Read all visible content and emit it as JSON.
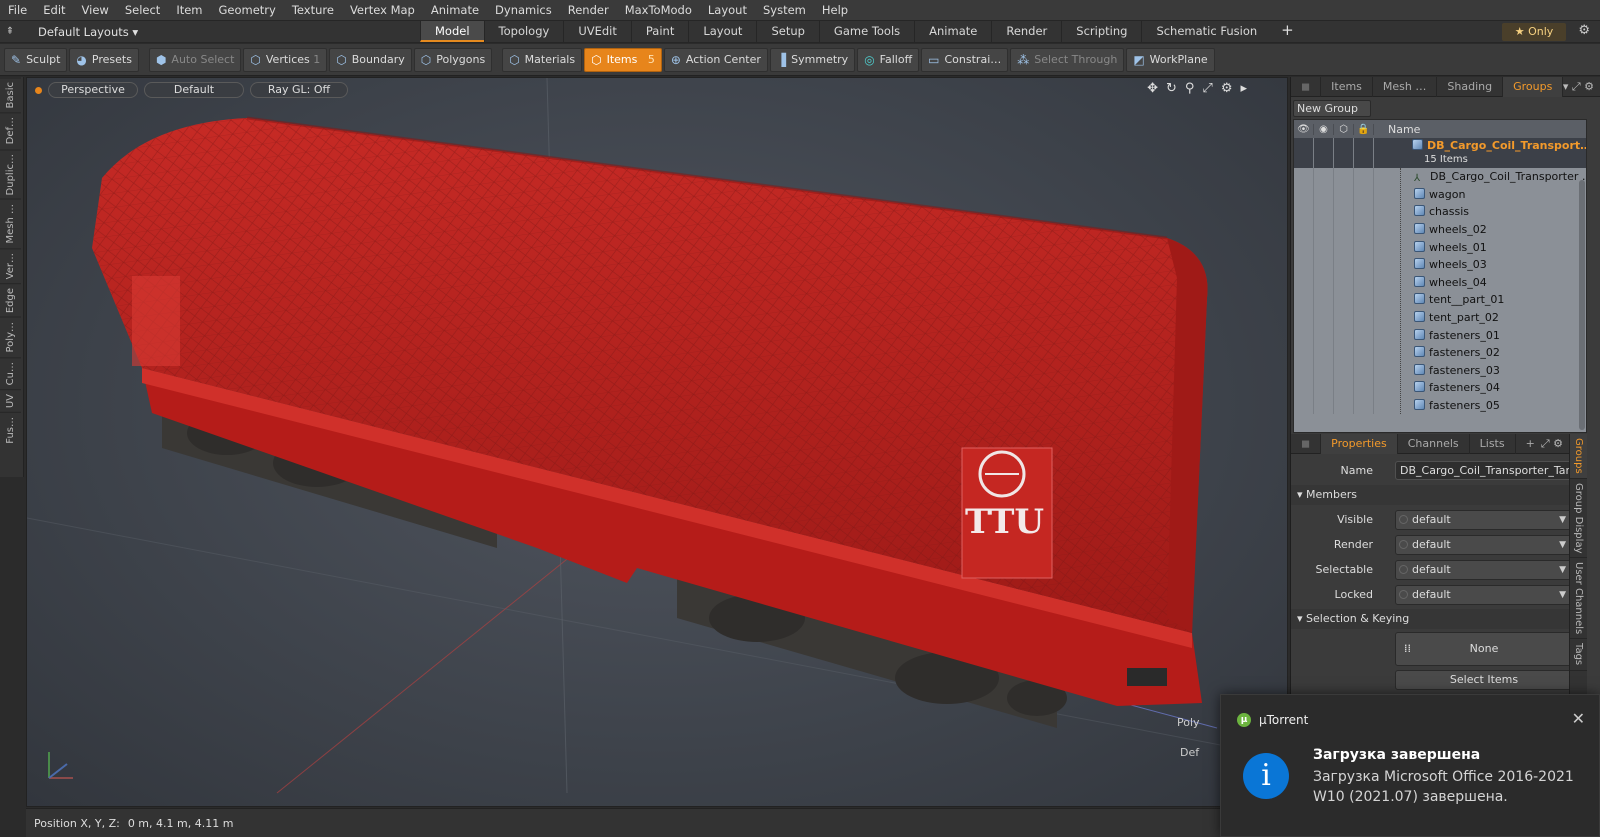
{
  "menu": [
    "File",
    "Edit",
    "View",
    "Select",
    "Item",
    "Geometry",
    "Texture",
    "Vertex Map",
    "Animate",
    "Dynamics",
    "Render",
    "MaxToModo",
    "Layout",
    "System",
    "Help"
  ],
  "layouts": {
    "label": "Default Layouts ▾"
  },
  "tabs": [
    {
      "label": "Model",
      "active": true
    },
    {
      "label": "Topology"
    },
    {
      "label": "UVEdit"
    },
    {
      "label": "Paint"
    },
    {
      "label": "Layout"
    },
    {
      "label": "Setup"
    },
    {
      "label": "Game Tools"
    },
    {
      "label": "Animate"
    },
    {
      "label": "Render"
    },
    {
      "label": "Scripting"
    },
    {
      "label": "Schematic Fusion"
    }
  ],
  "only_label": "★ Only",
  "toolbar": {
    "sculpt": "Sculpt",
    "presets": "Presets",
    "auto_select": "Auto Select",
    "vertices": "Vertices",
    "vertices_count": "1",
    "boundary": "Boundary",
    "polygons": "Polygons",
    "materials": "Materials",
    "items": "Items",
    "items_count": "5",
    "action_center": "Action Center",
    "symmetry": "Symmetry",
    "falloff": "Falloff",
    "constraints": "Constrai…",
    "select_through": "Select Through",
    "workplane": "WorkPlane"
  },
  "left_tabs": [
    "Basic",
    "Def…",
    "Duplic…",
    "Mesh …",
    "Ver…",
    "Edge",
    "Poly…",
    "Cu…",
    "UV",
    "Fus…"
  ],
  "viewport": {
    "view": "Perspective",
    "shading": "Default",
    "raygl": "Ray GL: Off",
    "poly_label": "Poly",
    "def_label": "Def",
    "decal_text": "TTU"
  },
  "status": {
    "label": "Position X, Y, Z:",
    "value": "0 m, 4.1 m, 4.11 m"
  },
  "groups_panel": {
    "tabs": [
      "Items",
      "Mesh …",
      "Shading",
      "Groups"
    ],
    "active_tab": "Groups",
    "new_group": "New Group",
    "col_name": "Name",
    "group_name": "DB_Cargo_Coil_Transport…",
    "group_count": "15 Items",
    "items": [
      {
        "name": "DB_Cargo_Coil_Transporter …",
        "type": "locator"
      },
      {
        "name": "wagon",
        "type": "mesh"
      },
      {
        "name": "chassis",
        "type": "mesh"
      },
      {
        "name": "wheels_02",
        "type": "mesh"
      },
      {
        "name": "wheels_01",
        "type": "mesh"
      },
      {
        "name": "wheels_03",
        "type": "mesh"
      },
      {
        "name": "wheels_04",
        "type": "mesh"
      },
      {
        "name": "tent__part_01",
        "type": "mesh"
      },
      {
        "name": "tent_part_02",
        "type": "mesh"
      },
      {
        "name": "fasteners_01",
        "type": "mesh"
      },
      {
        "name": "fasteners_02",
        "type": "mesh"
      },
      {
        "name": "fasteners_03",
        "type": "mesh"
      },
      {
        "name": "fasteners_04",
        "type": "mesh"
      },
      {
        "name": "fasteners_05",
        "type": "mesh"
      }
    ]
  },
  "props_panel": {
    "tabs": [
      "Properties",
      "Channels",
      "Lists"
    ],
    "name_label": "Name",
    "name_value": "DB_Cargo_Coil_Transporter_Tarp",
    "members_section": "Members",
    "visible_label": "Visible",
    "visible_value": "default",
    "render_label": "Render",
    "render_value": "default",
    "selectable_label": "Selectable",
    "selectable_value": "default",
    "locked_label": "Locked",
    "locked_value": "default",
    "selkey_section": "Selection & Keying",
    "none_label": "None",
    "select_items": "Select Items",
    "side_tabs": [
      "Groups",
      "Group Display",
      "User Channels",
      "Tags"
    ]
  },
  "toast": {
    "app": "µTorrent",
    "title": "Загрузка завершена",
    "message": "Загрузка Microsoft Office 2016-2021 W10 (2021.07) завершена."
  },
  "colors": {
    "accent": "#e7851b",
    "wagon_red": "#c0201d",
    "group_text": "#f39a2b",
    "info_blue": "#0a76d6"
  }
}
